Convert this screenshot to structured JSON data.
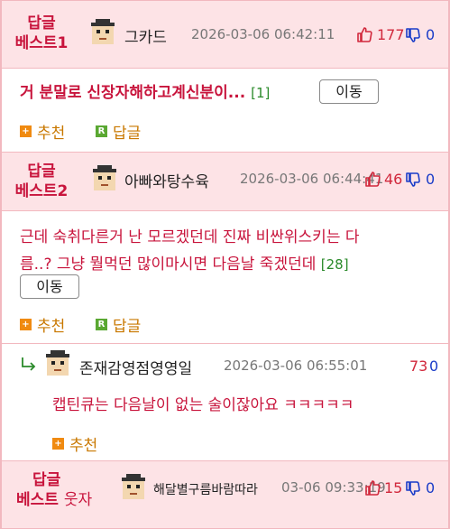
{
  "posts": [
    {
      "best_label_1": "답글",
      "best_label_2": "베스트1",
      "username": "그카드",
      "date": "2026-03-06 06:42:11",
      "up": "177",
      "down": "0",
      "title": "거 분말로 신장자해하고계신분이...",
      "title_count": "[1]",
      "move_label": "이동",
      "recommend_label": "추천",
      "reply_label": "답글"
    },
    {
      "best_label_1": "답글",
      "best_label_2": "베스트2",
      "username": "아빠와탕수육",
      "date": "2026-03-06 06:44:41",
      "up": "46",
      "down": "0",
      "line1": "근데 숙취다른거 난 모르겠던데 진짜 비싼위스키는 다",
      "line2": "름..? 그냥 뭘먹던 많이마시면 다음날 죽겠던데",
      "text_count": "[28]",
      "move_label": "이동",
      "recommend_label": "추천",
      "reply_label": "답글"
    }
  ],
  "reply": {
    "username": "존재감영점영영일",
    "date": "2026-03-06 06:55:01",
    "up": "73",
    "down": "0",
    "text": "캡틴큐는 다음날이 없는 술이잖아요 ㅋㅋㅋㅋㅋ",
    "recommend_label": "추천"
  },
  "post3": {
    "best_label_1": "답글",
    "best_label_2": "베스트",
    "best_extra": "웃자",
    "username": "해달별구름바람따라",
    "date": "03-06 09:33:19",
    "up": "15",
    "down": "0"
  },
  "colors": {
    "accent_red": "#c8143c",
    "header_pink": "#fde3e6",
    "border_pink": "#f2b8bf",
    "down_blue": "#1a3cc8",
    "count_green": "#2a8a2a",
    "action_orange": "#c97800"
  }
}
